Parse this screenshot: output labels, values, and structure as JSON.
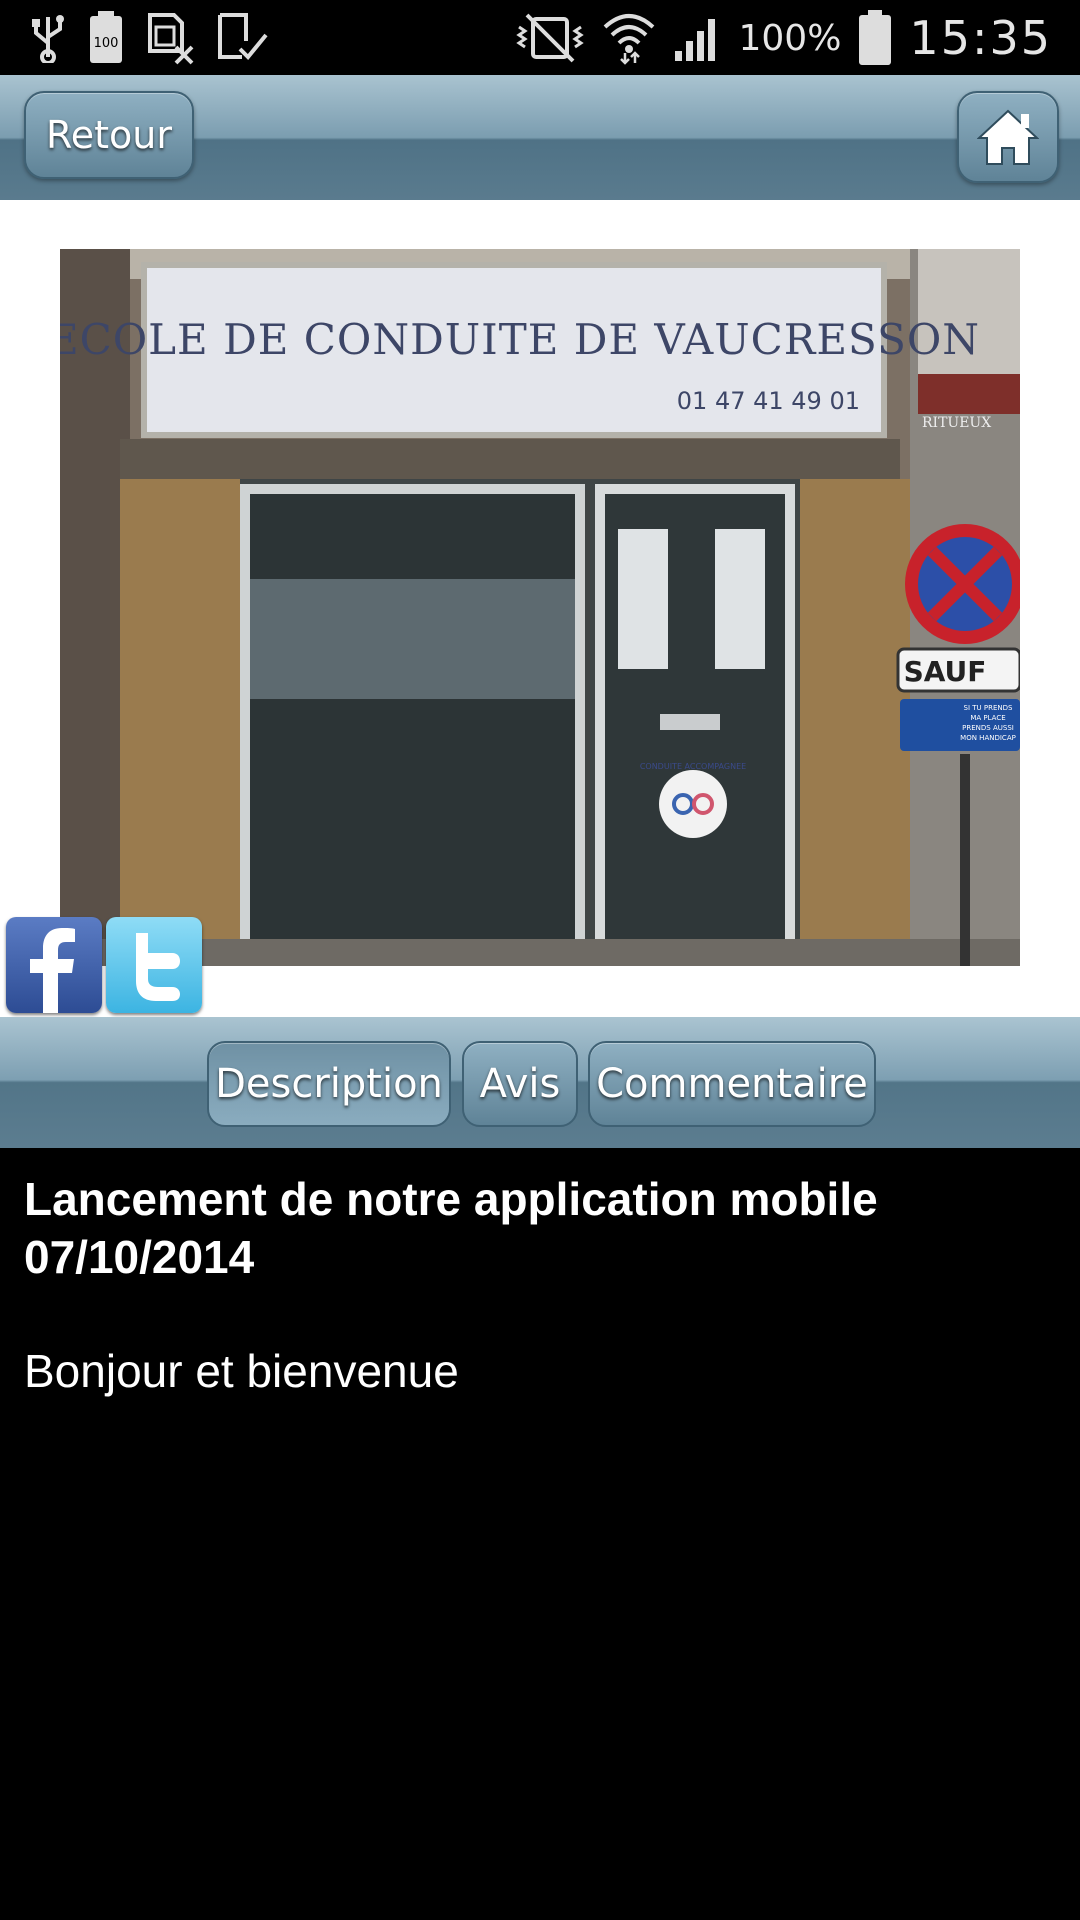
{
  "status_bar": {
    "battery_small_label": "100",
    "battery_percent": "100%",
    "time": "15:35"
  },
  "header": {
    "back_label": "Retour"
  },
  "photo": {
    "sign_title": "ECOLE DE CONDUITE DE VAUCRESSON",
    "sign_phone": "01 47 41 49 01",
    "shop_label": "RITUEUX",
    "parking_sign": "SAUF",
    "small_sign_lines": [
      "SI TU PRENDS",
      "MA PLACE",
      "PRENDS AUSSI",
      "MON HANDICAP"
    ],
    "door_sticker": "CONDUITE ACCOMPAGNEE"
  },
  "tabs": {
    "description": "Description",
    "avis": "Avis",
    "commentaire": "Commentaire",
    "active": "description"
  },
  "content": {
    "headline_line1": "Lancement de notre application mobile",
    "headline_line2": "07/10/2014",
    "body": "Bonjour et bienvenue"
  },
  "colors": {
    "bar_top": "#a9c3d0",
    "bar_bottom": "#5a7b8e",
    "facebook": "#3b5998",
    "twitter": "#55c1eb"
  }
}
